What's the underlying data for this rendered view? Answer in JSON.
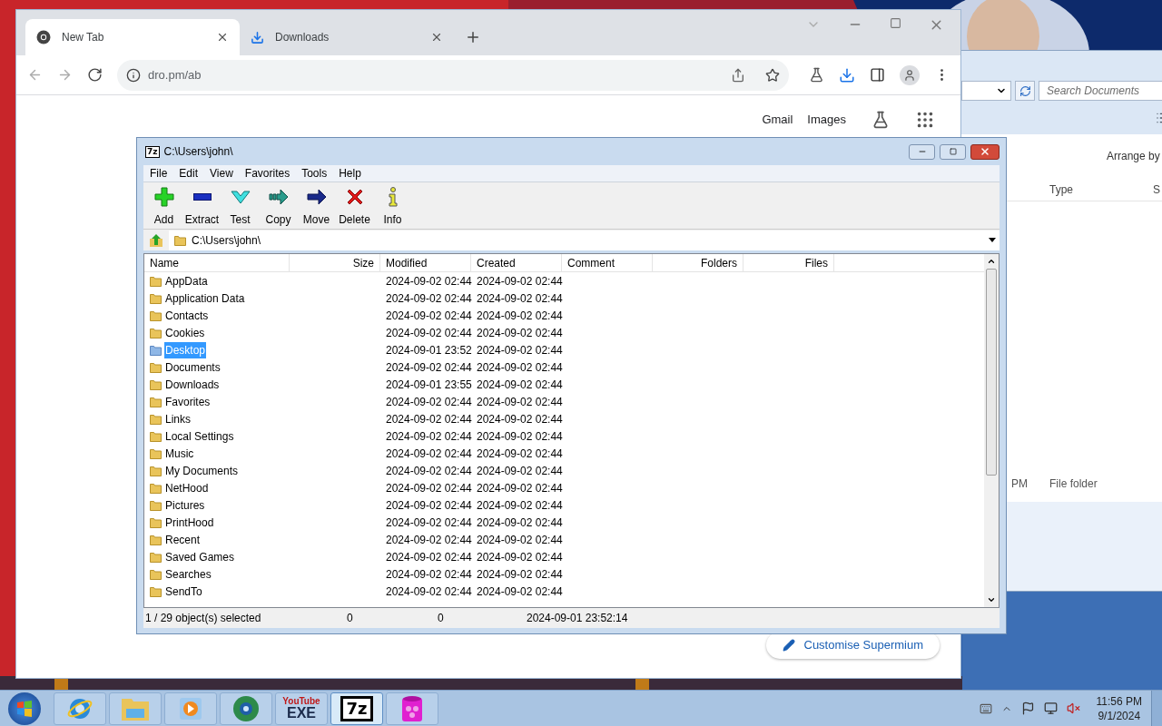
{
  "explorer": {
    "search": {
      "placeholder": "Search Documents"
    },
    "arrange_label": "Arrange by",
    "columns": [
      "Type",
      "S"
    ],
    "row": {
      "column_1": "PM",
      "type": "File folder"
    }
  },
  "browser": {
    "tabs": [
      {
        "title": "New Tab",
        "kind": "chrome",
        "selected": true
      },
      {
        "title": "Downloads",
        "kind": "download",
        "selected": false
      }
    ],
    "address": "dro.pm/ab",
    "links": [
      "Gmail",
      "Images"
    ],
    "customise_button": "Customise Supermium"
  },
  "sevenzip": {
    "title_icon": "7z",
    "title": "C:\\Users\\john\\",
    "menu": [
      "File",
      "Edit",
      "View",
      "Favorites",
      "Tools",
      "Help"
    ],
    "toolbar": [
      {
        "label": "Add",
        "kind": "add"
      },
      {
        "label": "Extract",
        "kind": "extract"
      },
      {
        "label": "Test",
        "kind": "test"
      },
      {
        "label": "Copy",
        "kind": "copy"
      },
      {
        "label": "Move",
        "kind": "move"
      },
      {
        "label": "Delete",
        "kind": "delete"
      },
      {
        "label": "Info",
        "kind": "info"
      }
    ],
    "path": "C:\\Users\\john\\",
    "columns": [
      "Name",
      "Size",
      "Modified",
      "Created",
      "Comment",
      "Folders",
      "Files"
    ],
    "rows": [
      {
        "name": "AppData",
        "modified": "2024-09-02 02:44",
        "created": "2024-09-02 02:44",
        "selected": false
      },
      {
        "name": "Application Data",
        "modified": "2024-09-02 02:44",
        "created": "2024-09-02 02:44",
        "selected": false
      },
      {
        "name": "Contacts",
        "modified": "2024-09-02 02:44",
        "created": "2024-09-02 02:44",
        "selected": false
      },
      {
        "name": "Cookies",
        "modified": "2024-09-02 02:44",
        "created": "2024-09-02 02:44",
        "selected": false
      },
      {
        "name": "Desktop",
        "modified": "2024-09-01 23:52",
        "created": "2024-09-02 02:44",
        "selected": true
      },
      {
        "name": "Documents",
        "modified": "2024-09-02 02:44",
        "created": "2024-09-02 02:44",
        "selected": false
      },
      {
        "name": "Downloads",
        "modified": "2024-09-01 23:55",
        "created": "2024-09-02 02:44",
        "selected": false
      },
      {
        "name": "Favorites",
        "modified": "2024-09-02 02:44",
        "created": "2024-09-02 02:44",
        "selected": false
      },
      {
        "name": "Links",
        "modified": "2024-09-02 02:44",
        "created": "2024-09-02 02:44",
        "selected": false
      },
      {
        "name": "Local Settings",
        "modified": "2024-09-02 02:44",
        "created": "2024-09-02 02:44",
        "selected": false
      },
      {
        "name": "Music",
        "modified": "2024-09-02 02:44",
        "created": "2024-09-02 02:44",
        "selected": false
      },
      {
        "name": "My Documents",
        "modified": "2024-09-02 02:44",
        "created": "2024-09-02 02:44",
        "selected": false
      },
      {
        "name": "NetHood",
        "modified": "2024-09-02 02:44",
        "created": "2024-09-02 02:44",
        "selected": false
      },
      {
        "name": "Pictures",
        "modified": "2024-09-02 02:44",
        "created": "2024-09-02 02:44",
        "selected": false
      },
      {
        "name": "PrintHood",
        "modified": "2024-09-02 02:44",
        "created": "2024-09-02 02:44",
        "selected": false
      },
      {
        "name": "Recent",
        "modified": "2024-09-02 02:44",
        "created": "2024-09-02 02:44",
        "selected": false
      },
      {
        "name": "Saved Games",
        "modified": "2024-09-02 02:44",
        "created": "2024-09-02 02:44",
        "selected": false
      },
      {
        "name": "Searches",
        "modified": "2024-09-02 02:44",
        "created": "2024-09-02 02:44",
        "selected": false
      },
      {
        "name": "SendTo",
        "modified": "2024-09-02 02:44",
        "created": "2024-09-02 02:44",
        "selected": false
      }
    ],
    "status": [
      "1 / 29 object(s) selected",
      "0",
      "0",
      "2024-09-01 23:52:14"
    ]
  },
  "taskbar": {
    "apps": [
      {
        "kind": "ie",
        "selected": false
      },
      {
        "kind": "folder",
        "selected": false
      },
      {
        "kind": "media",
        "selected": false
      },
      {
        "kind": "globe",
        "selected": false
      },
      {
        "kind": "youtube",
        "logo": "YouTube",
        "label": "EXE",
        "selected": false
      },
      {
        "kind": "sevenzip",
        "label": "7z",
        "selected": true
      },
      {
        "kind": "pink",
        "selected": false
      }
    ],
    "time": "11:56 PM",
    "date": "9/1/2024"
  }
}
